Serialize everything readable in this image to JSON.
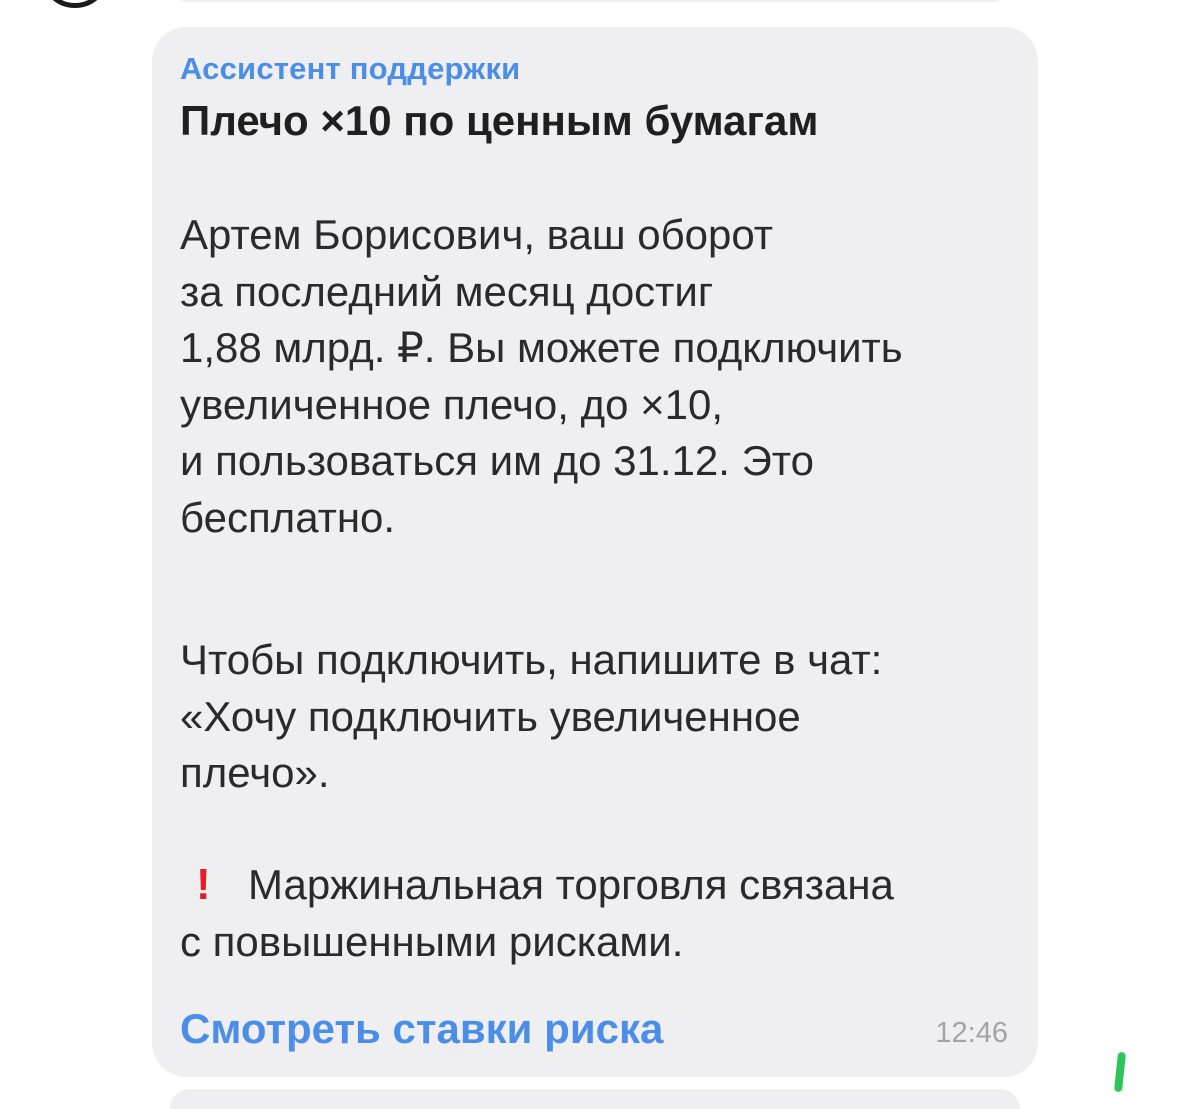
{
  "message": {
    "sender": "Ассистент поддержки",
    "title": "Плечо ×10 по ценным бумагам",
    "paragraph1": [
      "Артем Борисович, ваш оборот",
      "за последний месяц достиг",
      "1,88 млрд. ₽. Вы можете подключить",
      "увеличенное плечо, до ×10,",
      "и пользоваться им до 31.12. Это",
      "бесплатно."
    ],
    "paragraph2": [
      "Чтобы подключить, напишите в чат:",
      "«Хочу подключить увеличенное",
      "плечо»."
    ],
    "warning": {
      "icon": "exclamation-mark-icon",
      "icon_glyph": "!",
      "lines": [
        "Маржинальная торговля связана",
        "с повышенными рисками."
      ]
    },
    "link_label": "Смотреть ставки риска",
    "time": "12:46"
  },
  "colors": {
    "bubble": "#efeff1",
    "accent": "#4b8ee7",
    "warning": "#e41e26",
    "timestamp": "#a3a3a8",
    "indicator": "#2ec55a"
  }
}
